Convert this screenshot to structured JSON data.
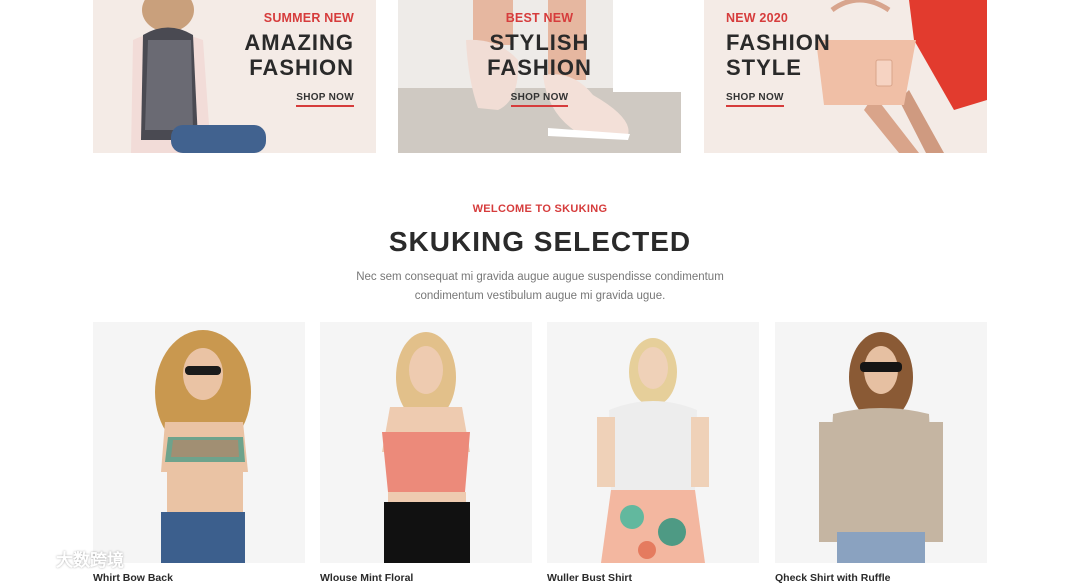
{
  "banners": [
    {
      "kicker": "SUMMER NEW",
      "line1": "AMAZING",
      "line2": "FASHION",
      "cta": "SHOP NOW"
    },
    {
      "kicker": "BEST NEW",
      "line1": "STYLISH",
      "line2": "FASHION",
      "cta": "SHOP NOW"
    },
    {
      "kicker": "NEW 2020",
      "line1": "FASHION",
      "line2": "STYLE",
      "cta": "SHOP NOW"
    }
  ],
  "section": {
    "kicker": "WELCOME TO SKUKING",
    "title": "SKUKING SELECTED",
    "desc_line1": "Nec sem consequat mi gravida augue augue suspendisse condimentum",
    "desc_line2": "condimentum vestibulum augue mi gravida ugue."
  },
  "products": [
    {
      "name": "Whirt Bow Back"
    },
    {
      "name": "Wlouse Mint Floral"
    },
    {
      "name": "Wuller Bust Shirt"
    },
    {
      "name": "Qheck Shirt with Ruffle"
    }
  ],
  "watermark": {
    "text": "大数跨境"
  },
  "colors": {
    "accent": "#d63c3c",
    "heading": "#2a2a2a",
    "muted": "#777777",
    "tile_bg": "#f5f5f5"
  }
}
